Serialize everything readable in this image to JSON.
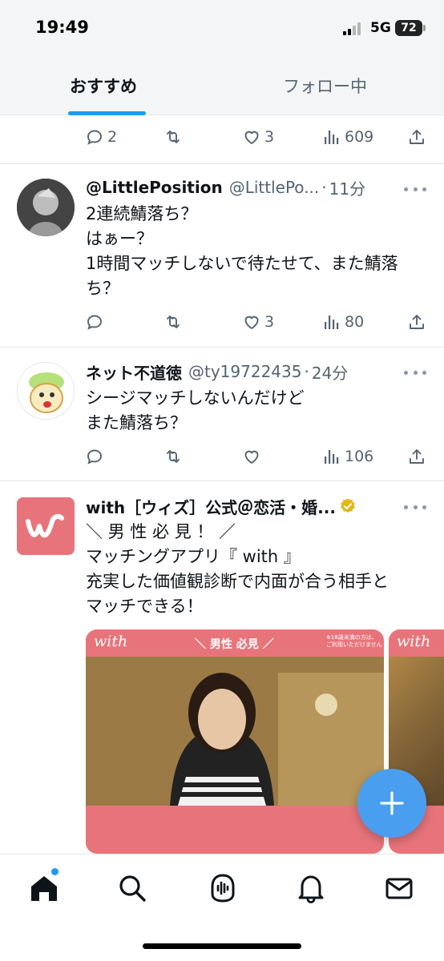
{
  "status": {
    "time": "19:49",
    "network": "5G",
    "battery": "72"
  },
  "tabs": [
    {
      "label": "おすすめ",
      "active": true
    },
    {
      "label": "フォロー中",
      "active": false
    }
  ],
  "top_actions": {
    "replies": "2",
    "reposts": "",
    "likes": "3",
    "views": "609"
  },
  "tweets": [
    {
      "name": "@LittlePosition",
      "handle": "@LittlePo...",
      "time": "11分",
      "lines": [
        "2連続鯖落ち？",
        "はぁー？",
        "1時間マッチしないで待たせて、また鯖落",
        "ち？"
      ],
      "replies": "",
      "reposts": "",
      "likes": "3",
      "views": "80"
    },
    {
      "name": "ネット不道徳",
      "handle": "@ty19722435",
      "time": "24分",
      "lines": [
        "シージマッチしないんだけど",
        "また鯖落ち？"
      ],
      "replies": "",
      "reposts": "",
      "likes": "",
      "views": "106"
    },
    {
      "name": "with［ウィズ］公式＠恋活・婚...",
      "handle": "",
      "time": "",
      "verified": true,
      "lines": [
        "＼ 男 性 必 見 ！ ／",
        "マッチングアプリ『 with 』",
        "充実した価値観診断で内面が合う相手と",
        "マッチできる！"
      ],
      "media": {
        "logo": "with",
        "banner": "＼ 男性 必見 ／",
        "note": "※18歳未満の方は、\nご利用いただけません"
      }
    }
  ],
  "icons": {
    "reply": "reply-icon",
    "repost": "repost-icon",
    "like": "heart-icon",
    "views": "views-icon",
    "share": "share-icon",
    "fab": "plus-icon",
    "nav": [
      "home-icon",
      "search-icon",
      "spaces-icon",
      "bell-icon",
      "mail-icon"
    ]
  },
  "colors": {
    "accent": "#1d9bf0",
    "fab": "#4a9ef0",
    "with_brand": "#e8747b",
    "muted": "#536471"
  }
}
